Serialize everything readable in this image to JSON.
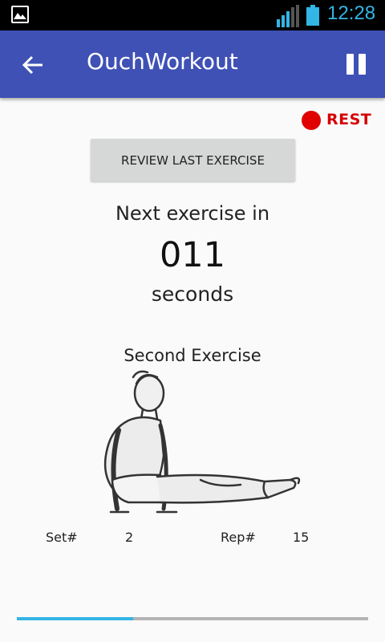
{
  "status_bar": {
    "time": "12:28",
    "icons": [
      "image-notification-icon",
      "signal-icon",
      "battery-icon"
    ],
    "accent_color": "#33b5e5"
  },
  "app_bar": {
    "title": "OuchWorkout",
    "color": "#3f51b5",
    "back_icon": "arrow-back-icon",
    "pause_icon": "pause-icon"
  },
  "rest_indicator": {
    "label": "REST",
    "color": "#e00000"
  },
  "review_button": {
    "label": "REVIEW LAST EXERCISE"
  },
  "countdown": {
    "prefix": "Next exercise in",
    "value": "011",
    "unit": "seconds"
  },
  "exercise": {
    "name": "Second Exercise",
    "image_icon": "l-sit-exercise-illustration",
    "set_label": "Set#",
    "set_value": "2",
    "rep_label": "Rep#",
    "rep_value": "15"
  },
  "progress": {
    "fraction": 0.33
  }
}
